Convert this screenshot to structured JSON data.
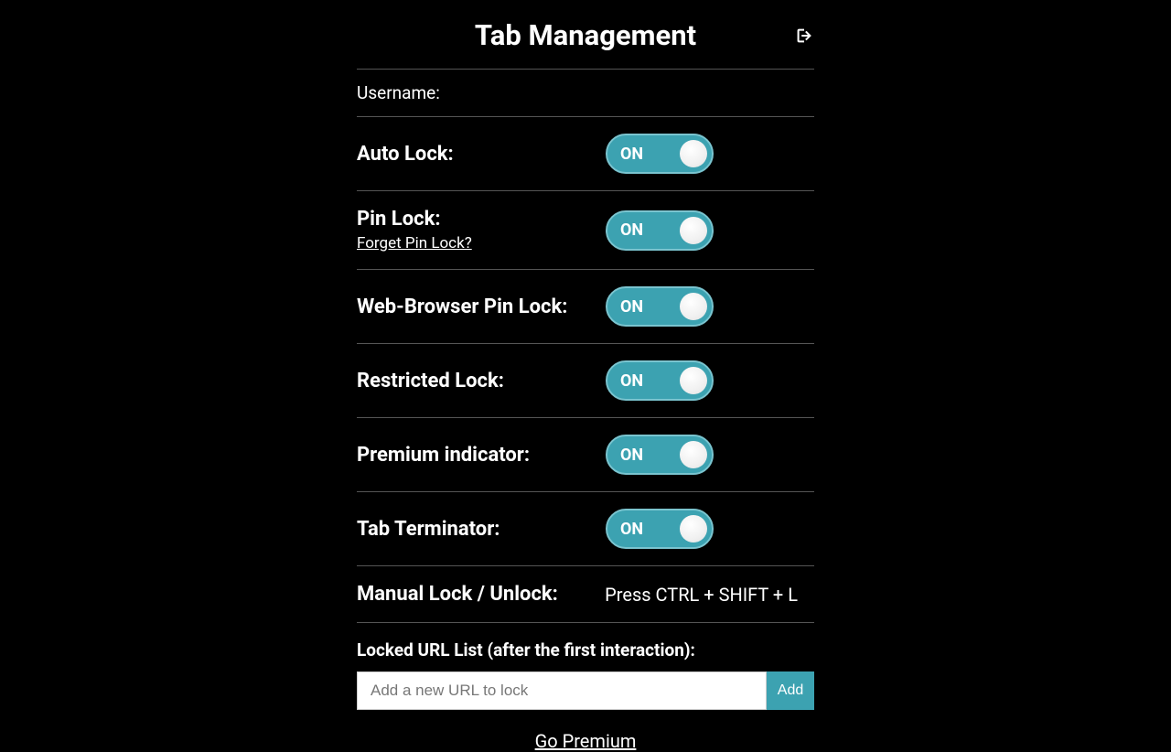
{
  "header": {
    "title": "Tab Management"
  },
  "username": {
    "label": "Username:"
  },
  "settings": {
    "autoLock": {
      "label": "Auto Lock:",
      "state": "ON"
    },
    "pinLock": {
      "label": "Pin Lock:",
      "state": "ON",
      "forgetLink": "Forget Pin Lock?"
    },
    "webBrowserPinLock": {
      "label": "Web-Browser Pin Lock:",
      "state": "ON"
    },
    "restrictedLock": {
      "label": "Restricted Lock:",
      "state": "ON"
    },
    "premiumIndicator": {
      "label": "Premium indicator:",
      "state": "ON"
    },
    "tabTerminator": {
      "label": "Tab Terminator:",
      "state": "ON"
    },
    "manualLock": {
      "label": "Manual Lock / Unlock:",
      "value": "Press CTRL + SHIFT + L"
    }
  },
  "urlList": {
    "label": "Locked URL List (after the first interaction):",
    "placeholder": "Add a new URL to lock",
    "addButton": "Add"
  },
  "footer": {
    "premiumLink": "Go Premium"
  }
}
